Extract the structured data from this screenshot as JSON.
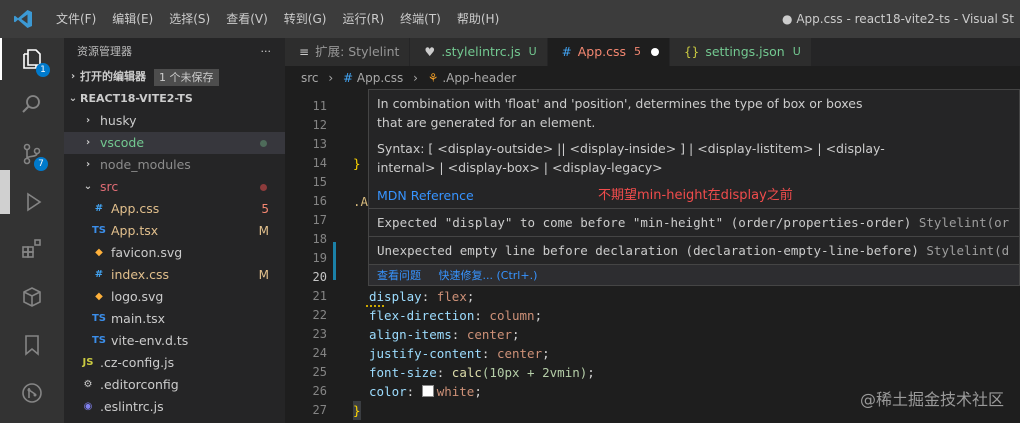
{
  "titlebar": {
    "menu": [
      "文件(F)",
      "编辑(E)",
      "选择(S)",
      "查看(V)",
      "转到(G)",
      "运行(R)",
      "终端(T)",
      "帮助(H)"
    ],
    "window_title": "● App.css - react18-vite2-ts - Visual St"
  },
  "activity": {
    "explorer_badge": "1",
    "scm_badge": "7"
  },
  "sidebar": {
    "title": "资源管理器",
    "more": "···",
    "open_editors": "打开的编辑器",
    "unsaved_badge": "1 个未保存",
    "project": "REACT18-VITE2-TS",
    "items": [
      {
        "label": "husky",
        "icon": "›",
        "status": "",
        "color": "#cccccc"
      },
      {
        "label": "vscode",
        "icon": "›",
        "status": "●",
        "color": "#73c991"
      },
      {
        "label": "node_modules",
        "icon": "›",
        "status": "",
        "color": "#8c8c8c"
      },
      {
        "label": "src",
        "icon": "⌄",
        "status": "●",
        "color": "#e06c75"
      },
      {
        "label": "App.css",
        "icon": "#",
        "status": "5",
        "color": "#e2c08d"
      },
      {
        "label": "App.tsx",
        "icon": "TS",
        "status": "M",
        "color": "#e2c08d"
      },
      {
        "label": "favicon.svg",
        "icon": "◆",
        "status": "",
        "color": "#cccccc"
      },
      {
        "label": "index.css",
        "icon": "#",
        "status": "M",
        "color": "#e2c08d"
      },
      {
        "label": "logo.svg",
        "icon": "◆",
        "status": "",
        "color": "#cccccc"
      },
      {
        "label": "main.tsx",
        "icon": "TS",
        "status": "",
        "color": "#cccccc"
      },
      {
        "label": "vite-env.d.ts",
        "icon": "TS",
        "status": "",
        "color": "#cccccc"
      },
      {
        "label": ".cz-config.js",
        "icon": "JS",
        "status": "",
        "color": "#cccccc"
      },
      {
        "label": ".editorconfig",
        "icon": "⚙",
        "status": "",
        "color": "#cccccc"
      },
      {
        "label": ".eslintrc.js",
        "icon": "◉",
        "status": "",
        "color": "#cccccc"
      }
    ]
  },
  "tabs": [
    {
      "label": "扩展: Stylelint",
      "icon": "≡",
      "suffix": "",
      "active": false
    },
    {
      "label": ".stylelintrc.js",
      "icon": "♥",
      "suffix": "U",
      "active": false
    },
    {
      "label": "App.css",
      "icon": "#",
      "suffix": "5",
      "active": true
    },
    {
      "label": "settings.json",
      "icon": "{}",
      "suffix": "U",
      "active": false
    }
  ],
  "breadcrumb": {
    "folder": "src",
    "file": "App.css",
    "symbol": ".App-header"
  },
  "editor": {
    "lines": [
      {
        "n": "11"
      },
      {
        "n": "12"
      },
      {
        "n": "13"
      },
      {
        "n": "14"
      },
      {
        "n": "15"
      },
      {
        "n": "16"
      },
      {
        "n": "17"
      },
      {
        "n": "18"
      },
      {
        "n": "19"
      },
      {
        "n": "20"
      },
      {
        "n": "21"
      },
      {
        "n": "22"
      },
      {
        "n": "23"
      },
      {
        "n": "24"
      },
      {
        "n": "25"
      },
      {
        "n": "26"
      },
      {
        "n": "27"
      }
    ],
    "brace14": "}",
    "sel16": ".A",
    "l21": {
      "prop": "display",
      "val": "flex"
    },
    "l22": {
      "prop": "flex-direction",
      "val": "column"
    },
    "l23": {
      "prop": "align-items",
      "val": "center"
    },
    "l24": {
      "prop": "justify-content",
      "val": "center"
    },
    "l25": {
      "prop": "font-size",
      "fn": "calc",
      "args": "(10px + 2vmin)"
    },
    "l26": {
      "prop": "color",
      "val": "white"
    },
    "brace27": "}"
  },
  "hover": {
    "desc1": "In combination with 'float' and 'position', determines the type of box or boxes",
    "desc2": "that are generated for an element.",
    "syntax1": "Syntax: [ <display-outside> || <display-inside> ] | <display-listitem> | <display-",
    "syntax2": "internal> | <display-box> | <display-legacy>",
    "mdn": "MDN Reference",
    "annotation": "不期望min-height在display之前",
    "diag1": "Expected \"display\" to come before \"min-height\" (order/properties-order)",
    "diag1_src": "Stylelint(or",
    "diag2": "Unexpected empty line before declaration (declaration-empty-line-before)",
    "diag2_src": "Stylelint(d",
    "action_view": "查看问题",
    "action_fix": "快速修复... (Ctrl+.)"
  },
  "watermark": "@稀土掘金技术社区"
}
